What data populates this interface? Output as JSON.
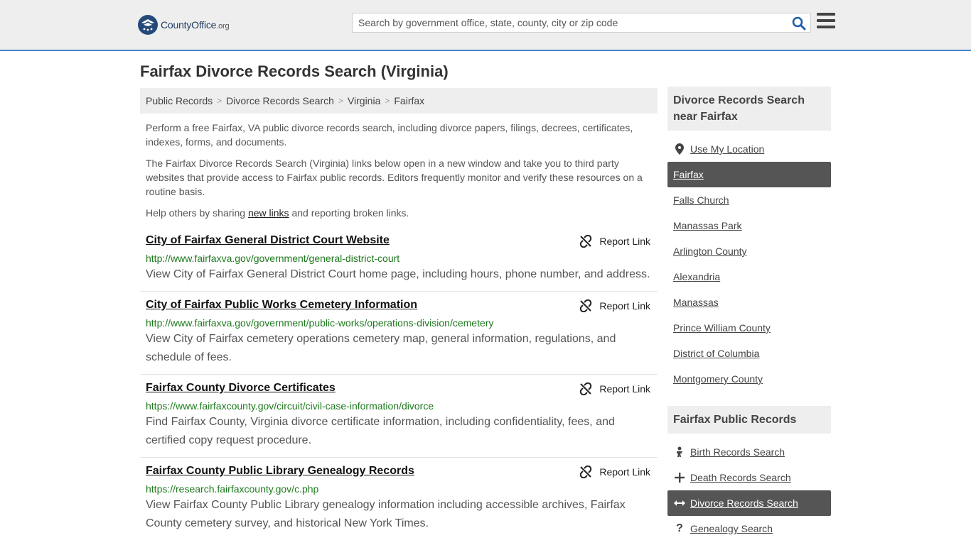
{
  "header": {
    "logo": {
      "name_main": "CountyOffice",
      "name_tld": ".org"
    },
    "search": {
      "placeholder": "Search by government office, state, county, city or zip code",
      "value": ""
    }
  },
  "page_title": "Fairfax Divorce Records Search (Virginia)",
  "breadcrumb": [
    "Public Records",
    "Divorce Records Search",
    "Virginia",
    "Fairfax"
  ],
  "intro": {
    "p1": "Perform a free Fairfax, VA public divorce records search, including divorce papers, filings, decrees, certificates, indexes, forms, and documents.",
    "p2": "The Fairfax Divorce Records Search (Virginia) links below open in a new window and take you to third party websites that provide access to Fairfax public records. Editors frequently monitor and verify these resources on a routine basis.",
    "p3_before": "Help others by sharing ",
    "p3_link": "new links",
    "p3_after": " and reporting broken links."
  },
  "report_label": "Report Link",
  "listings": [
    {
      "title": "City of Fairfax General District Court Website",
      "url": "http://www.fairfaxva.gov/government/general-district-court",
      "desc": "View City of Fairfax General District Court home page, including hours, phone number, and address."
    },
    {
      "title": "City of Fairfax Public Works Cemetery Information",
      "url": "http://www.fairfaxva.gov/government/public-works/operations-division/cemetery",
      "desc": "View City of Fairfax cemetery operations cemetery map, general information, regulations, and schedule of fees."
    },
    {
      "title": "Fairfax County Divorce Certificates",
      "url": "https://www.fairfaxcounty.gov/circuit/civil-case-information/divorce",
      "desc": "Find Fairfax County, Virginia divorce certificate information, including confidentiality, fees, and certified copy request procedure."
    },
    {
      "title": "Fairfax County Public Library Genealogy Records",
      "url": "https://research.fairfaxcounty.gov/c.php",
      "desc": "View Fairfax County Public Library genealogy information including accessible archives, Fairfax County cemetery survey, and historical New York Times."
    }
  ],
  "sidebar": {
    "nearby_heading": "Divorce Records Search near Fairfax",
    "use_location": "Use My Location",
    "nearby": [
      "Fairfax",
      "Falls Church",
      "Manassas Park",
      "Arlington County",
      "Alexandria",
      "Manassas",
      "Prince William County",
      "District of Columbia",
      "Montgomery County"
    ],
    "records_heading": "Fairfax Public Records",
    "records": [
      {
        "label": "Birth Records Search",
        "icon": "baby-icon"
      },
      {
        "label": "Death Records Search",
        "icon": "cross-icon"
      },
      {
        "label": "Divorce Records Search",
        "icon": "arrows-horizontal-icon"
      },
      {
        "label": "Genealogy Search",
        "icon": "question-icon"
      }
    ]
  },
  "colors": {
    "header_bg": "#eeeeee",
    "header_border": "#4a86c5",
    "url_green": "#1e7a1e",
    "active_bg": "#555555",
    "logo_blue": "#25497a"
  }
}
